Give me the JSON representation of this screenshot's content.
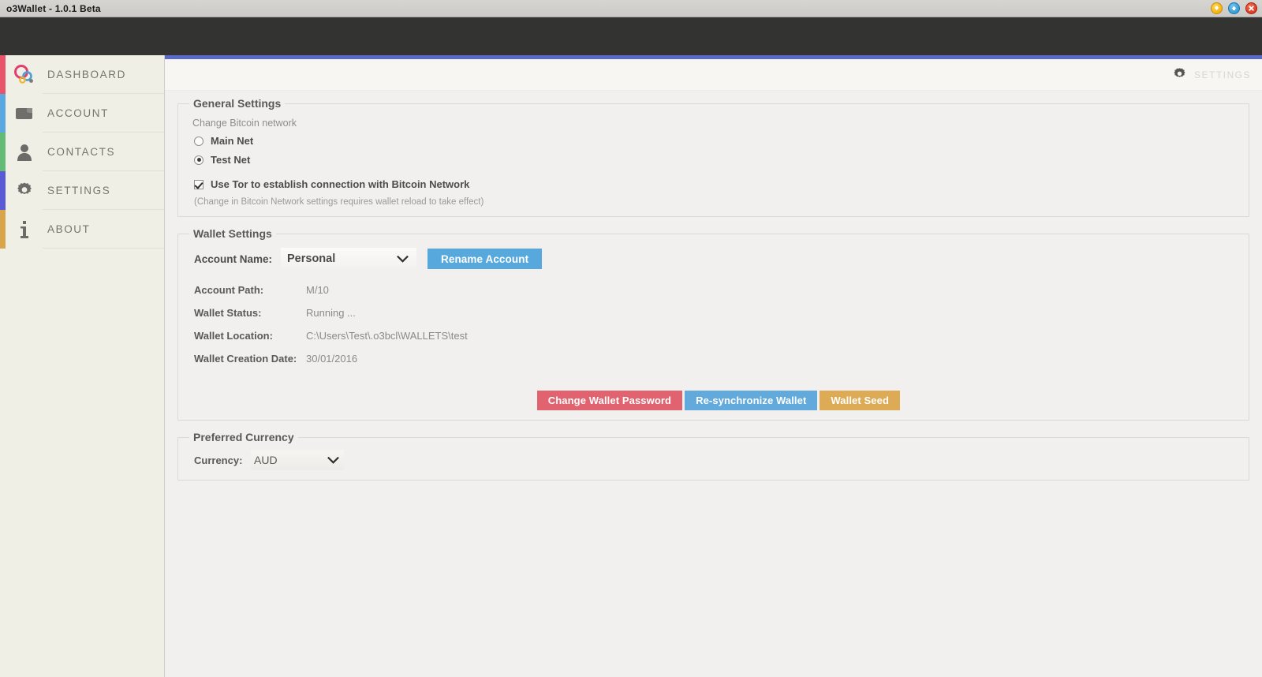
{
  "window": {
    "title": "o3Wallet - 1.0.1 Beta",
    "controls": {
      "minimize": "minimize-button",
      "maximize": "maximize-button",
      "close": "close-button"
    }
  },
  "sidebar": {
    "items": [
      {
        "label": "DASHBOARD",
        "icon": "logo-circles-icon",
        "accent": "#e8556b"
      },
      {
        "label": "ACCOUNT",
        "icon": "wallet-icon",
        "accent": "#5aa8e0"
      },
      {
        "label": "CONTACTS",
        "icon": "person-icon",
        "accent": "#63bb76"
      },
      {
        "label": "SETTINGS",
        "icon": "gear-icon",
        "accent": "#5a5ad6"
      },
      {
        "label": "ABOUT",
        "icon": "info-icon",
        "accent": "#d9a54a"
      }
    ]
  },
  "content_header": {
    "icon": "gear-icon",
    "label": "SETTINGS"
  },
  "general_settings": {
    "legend": "General Settings",
    "description": "Change Bitcoin network",
    "options": [
      {
        "label": "Main Net",
        "selected": false
      },
      {
        "label": "Test Net",
        "selected": true
      }
    ],
    "tor": {
      "label": "Use Tor to establish connection with Bitcoin Network",
      "checked": true
    },
    "note": "(Change in Bitcoin Network settings requires wallet reload to take effect)"
  },
  "wallet_settings": {
    "legend": "Wallet Settings",
    "account_name_label": "Account Name:",
    "account_name_value": "Personal",
    "rename_button": "Rename Account",
    "fields": [
      {
        "key": "Account Path:",
        "value": "M/10"
      },
      {
        "key": "Wallet Status:",
        "value": "Running ..."
      },
      {
        "key": "Wallet Location:",
        "value": "C:\\Users\\Test\\.o3bcl\\WALLETS\\test"
      },
      {
        "key": "Wallet Creation Date:",
        "value": "30/01/2016"
      }
    ],
    "buttons": [
      {
        "label": "Change Wallet Password",
        "color": "#e0636f"
      },
      {
        "label": "Re-synchronize Wallet",
        "color": "#62a9dc"
      },
      {
        "label": "Wallet Seed",
        "color": "#ddaa55"
      }
    ]
  },
  "preferred_currency": {
    "legend": "Preferred Currency",
    "currency_label": "Currency:",
    "currency_value": "AUD"
  }
}
